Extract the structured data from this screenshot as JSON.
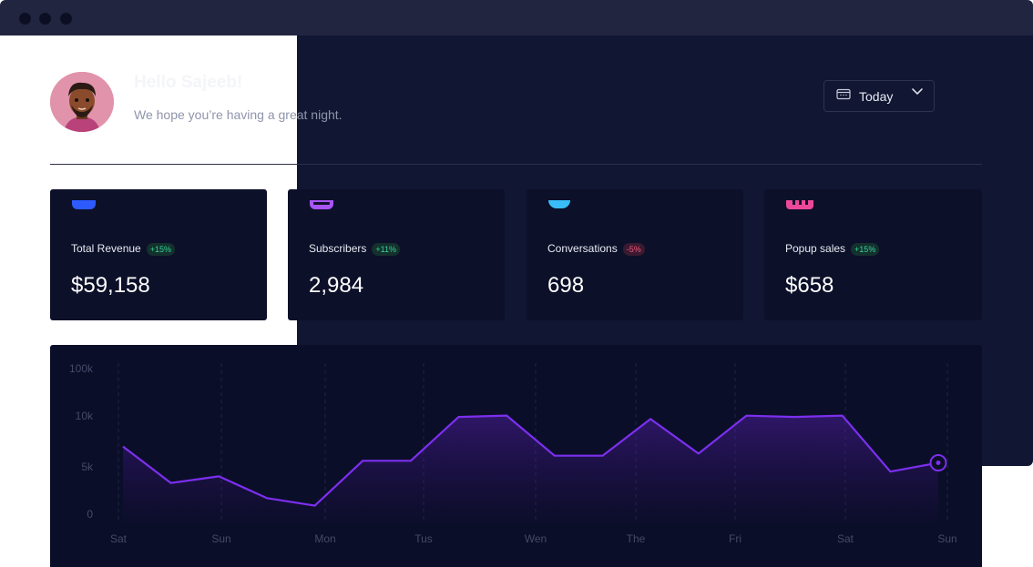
{
  "header": {
    "greeting": "Hello Sajeeb!",
    "subtitle": "We hope you’re having a great night.",
    "date_filter": "Today"
  },
  "stats": [
    {
      "label": "Total Revenue",
      "change": "+15%",
      "value": "$59,158",
      "trend": "up",
      "icon_color": "#2d5bff"
    },
    {
      "label": "Subscribers",
      "change": "+11%",
      "value": "2,984",
      "trend": "up",
      "icon_color": "#a855f7"
    },
    {
      "label": "Conversations",
      "change": "-5%",
      "value": "698",
      "trend": "down",
      "icon_color": "#38bdf8"
    },
    {
      "label": "Popup sales",
      "change": "+15%",
      "value": "$658",
      "trend": "up",
      "icon_color": "#ec4899"
    }
  ],
  "chart_data": {
    "type": "area",
    "y_ticks": [
      "100k",
      "10k",
      "5k",
      "0"
    ],
    "x_ticks": [
      "Sat",
      "Sun",
      "Mon",
      "Tus",
      "Wen",
      "The",
      "Fri",
      "Sat",
      "Sun"
    ],
    "series": [
      {
        "color": "#7c2ff0",
        "values": [
          7,
          3.3,
          4,
          1.7,
          0.9,
          5.6,
          5.6,
          9.9,
          10.7,
          6.1,
          6.1,
          9.7,
          6.3,
          10.6,
          9.9,
          10.5,
          4.5,
          5.4
        ]
      }
    ],
    "grid": true
  }
}
